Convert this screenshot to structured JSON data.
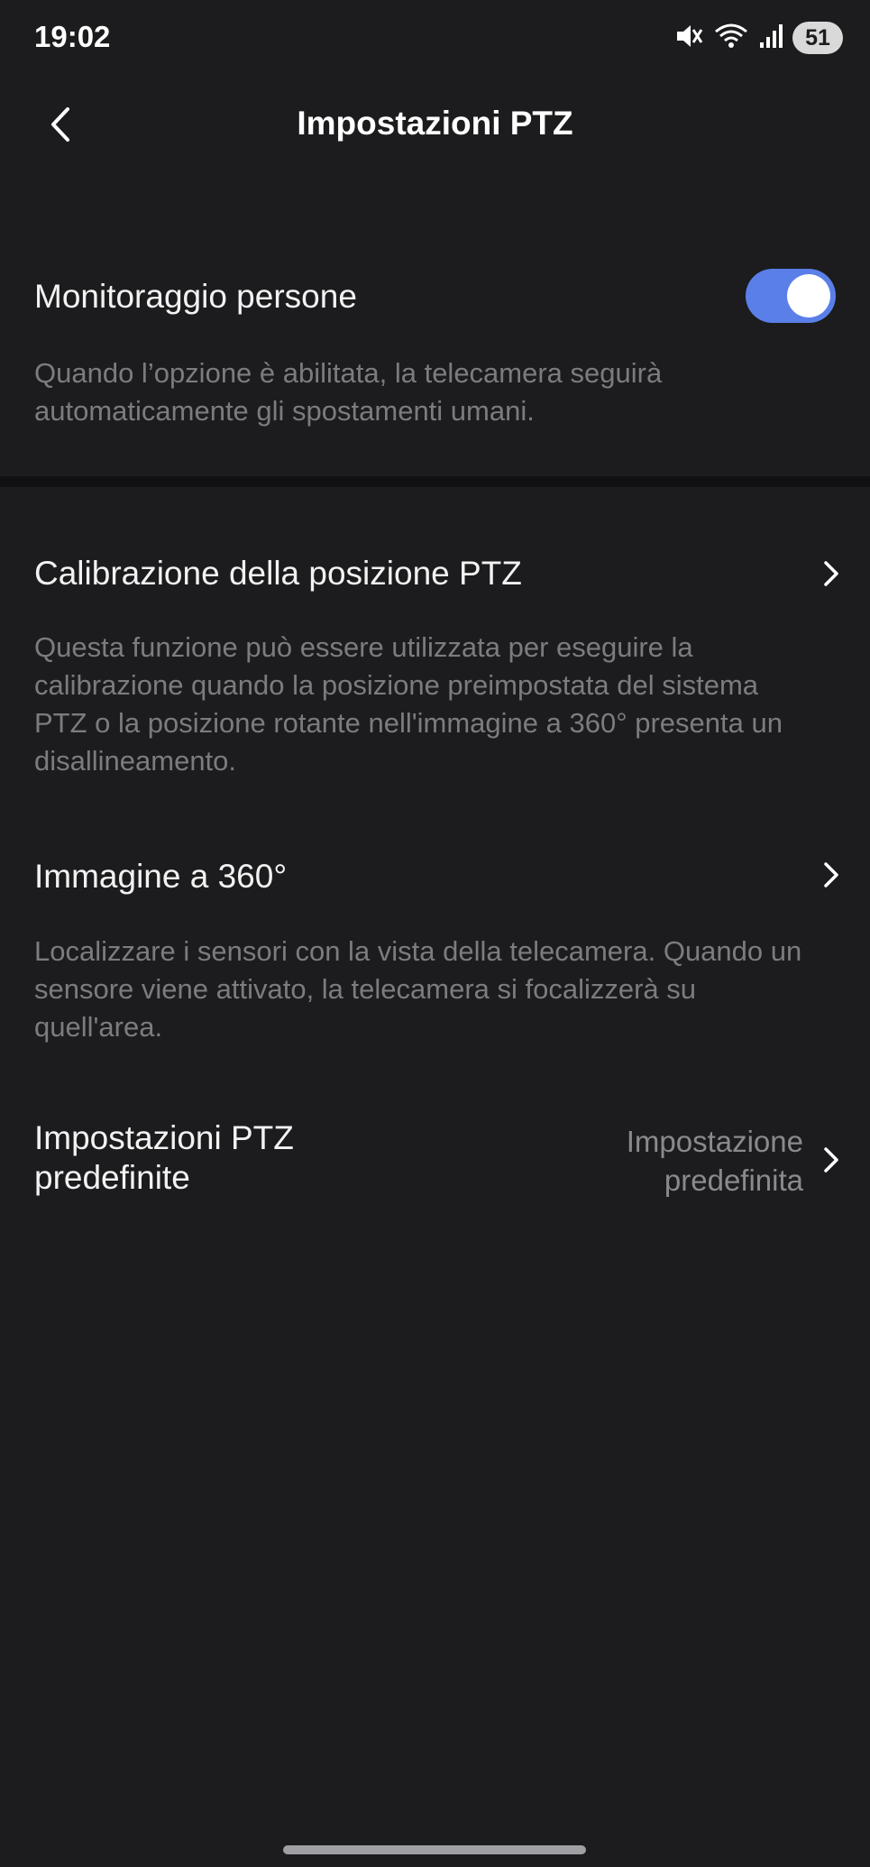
{
  "status_bar": {
    "time": "19:02",
    "icons": [
      "mute-icon",
      "wifi-icon",
      "signal-icon"
    ],
    "battery": "51"
  },
  "header": {
    "back_icon": "chevron-left-icon",
    "title": "Impostazioni PTZ"
  },
  "person_tracking": {
    "title": "Monitoraggio persone",
    "description": "Quando l’opzione è abilitata, la telecamera seguirà automaticamente gli spostamenti umani.",
    "enabled": true
  },
  "items": [
    {
      "title": "Calibrazione della posizione PTZ",
      "description": "Questa funzione può essere utilizzata per eseguire la calibrazione quando la posizione preimpostata del sistema PTZ o la posizione rotante nell'immagine a 360° presenta un disallineamento."
    },
    {
      "title": "Immagine a 360°",
      "description": "Localizzare i sensori con la vista della telecamera. Quando un sensore viene attivato, la telecamera si focalizzerà su quell'area."
    },
    {
      "title": "Impostazioni PTZ predefinite",
      "value": "Impostazione predefinita"
    }
  ],
  "colors": {
    "background": "#1c1c1e",
    "accent": "#5b7fe8",
    "secondary_text": "#7c7c80"
  }
}
